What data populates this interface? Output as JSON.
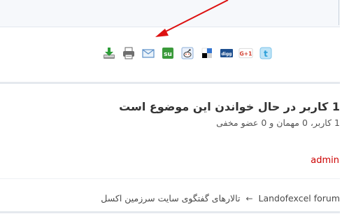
{
  "share_bar": {
    "icons": [
      {
        "name": "download-icon"
      },
      {
        "name": "print-icon"
      },
      {
        "name": "email-icon"
      },
      {
        "name": "stumbleupon-icon"
      },
      {
        "name": "reddit-icon"
      },
      {
        "name": "delicious-icon"
      },
      {
        "name": "digg-icon",
        "label": "digg"
      },
      {
        "name": "google-plus-icon",
        "label": "G+1"
      },
      {
        "name": "twitter-icon",
        "label": "t"
      }
    ]
  },
  "viewers": {
    "title": "1 کاربر در حال خواندن این موضوع است",
    "subtitle": "1 کاربر، 0 مهمان و 0 عضو مخفی",
    "users": [
      "admin"
    ]
  },
  "breadcrumb": {
    "items": [
      "Landofexcel forum",
      "تالارهای گفتگوی سایت سرزمین اکسل"
    ],
    "separator": "←"
  },
  "colors": {
    "arrow": "#dd1111",
    "user_link": "#cc0000",
    "separator": "#e5e9ee",
    "panel_bg": "#f6f8fb"
  }
}
